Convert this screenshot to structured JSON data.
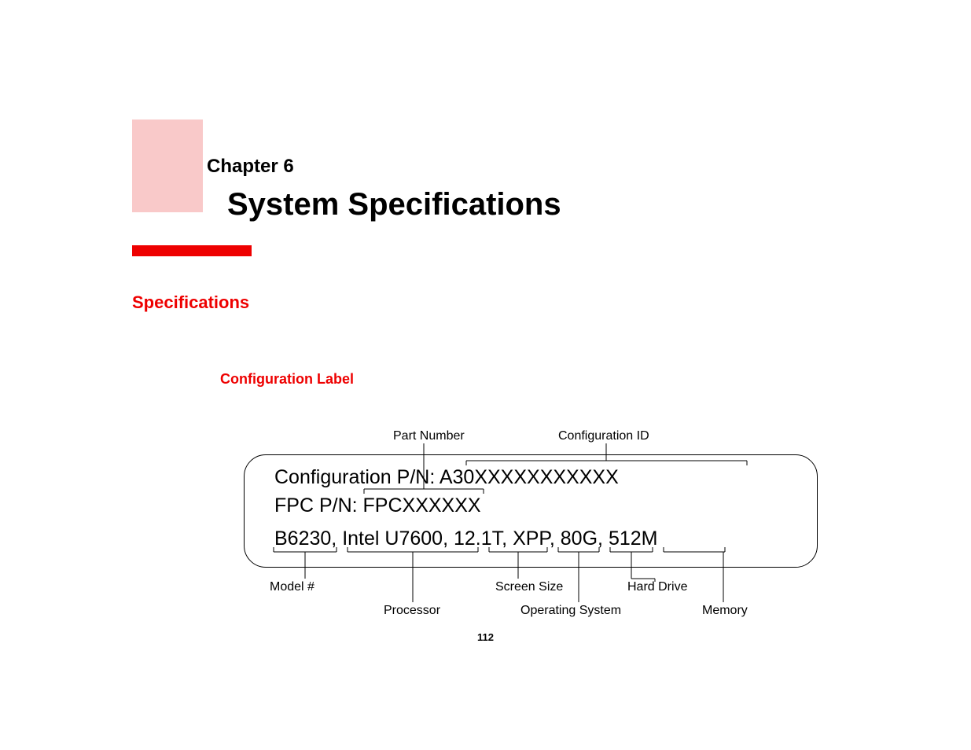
{
  "chapter_label": "Chapter 6",
  "chapter_title": "System Specifications",
  "section_heading": "Specifications",
  "sub_heading": "Configuration Label",
  "top_callouts": {
    "part_number": "Part Number",
    "configuration_id": "Configuration ID"
  },
  "label_lines": {
    "line1_prefix": "Configuration P/N: ",
    "line1_value": "A30XXXXXXXXXXX",
    "line2_prefix": "FPC P/N: ",
    "line2_value": "FPCXXXXXX",
    "line3_model": "B6230",
    "line3_sep": ", ",
    "line3_processor": "Intel U7600",
    "line3_screen": "12.1T",
    "line3_os": "XPP",
    "line3_hdd": "80G",
    "line3_mem": "512M"
  },
  "bottom_callouts": {
    "model": "Model #",
    "processor": "Processor",
    "screen_size": "Screen Size",
    "operating_system": "Operating System",
    "hard_drive": "Hard Drive",
    "memory": "Memory"
  },
  "page_number": "112"
}
